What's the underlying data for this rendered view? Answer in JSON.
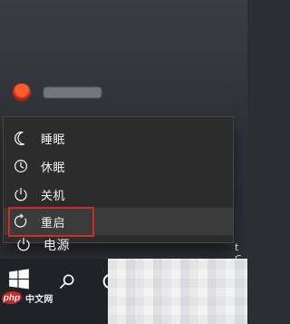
{
  "power_menu": {
    "items": [
      {
        "label": "睡眠",
        "icon": "moon-icon"
      },
      {
        "label": "休眠",
        "icon": "clock-icon"
      },
      {
        "label": "关机",
        "icon": "power-icon"
      },
      {
        "label": "重启",
        "icon": "restart-icon",
        "highlighted": true
      }
    ]
  },
  "start_menu": {
    "power_label": "电源",
    "partial_text": "t C"
  },
  "taskbar": {
    "start_icon": "windows-icon",
    "search_icon": "search-icon",
    "cortana_icon": "cortana-ring-icon"
  },
  "watermark": {
    "logo": "php",
    "text": "中文网"
  },
  "colors": {
    "highlight_border": "#c72e2e",
    "menu_background": "#2c2c2c",
    "selected_item_background": "#3b3b3b"
  }
}
